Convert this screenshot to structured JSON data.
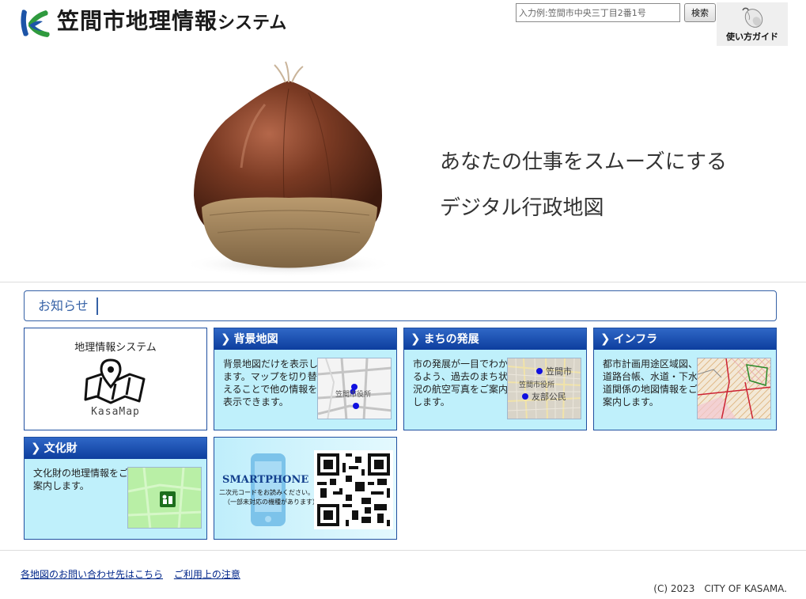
{
  "header": {
    "title_main": "笠間市地理情報",
    "title_suffix": "システム",
    "search_placeholder": "入力例:笠間市中央三丁目2番1号",
    "search_button": "検索",
    "guide_label": "使い方ガイド"
  },
  "hero": {
    "tagline_1": "あなたの仕事をスムーズにする",
    "tagline_2": "デジタル行政地図"
  },
  "notice": {
    "label": "お知らせ"
  },
  "tiles": {
    "gis": {
      "title": "地理情報システム",
      "subtitle": "KasaMap"
    },
    "background_map": {
      "title": "背景地図",
      "text": "背景地図だけを表示します。マップを切り替えることで他の情報を表示できます。",
      "map_label": "笠間市役所"
    },
    "town": {
      "title": "まちの発展",
      "text": "市の発展が一目でわかるよう、過去のまち状況の航空写真をご案内します。",
      "map_label_1": "笠間市",
      "map_label_2": "笠間市役所",
      "map_label_3": "友部公民"
    },
    "infra": {
      "title": "インフラ",
      "text": "都市計画用途区域図、道路台帳、水道・下水道関係の地図情報をご案内します。"
    },
    "culture": {
      "title": "文化財",
      "text": "文化財の地理情報をご案内します。"
    },
    "smartphone": {
      "title": "SMARTPHONE",
      "note_1": "二次元コードをお読みください。",
      "note_2": "（一部未対応の機種があります）"
    }
  },
  "footer": {
    "link_contact": "各地図のお問い合わせ先はこちら",
    "link_terms": "ご利用上の注意",
    "copyright": "(C) 2023　CITY OF KASAMA."
  },
  "colors": {
    "accent_blue": "#1f4fa0",
    "tile_background": "#bff0fb",
    "logo_green": "#2f9a3e",
    "logo_blue": "#1d54a7"
  }
}
